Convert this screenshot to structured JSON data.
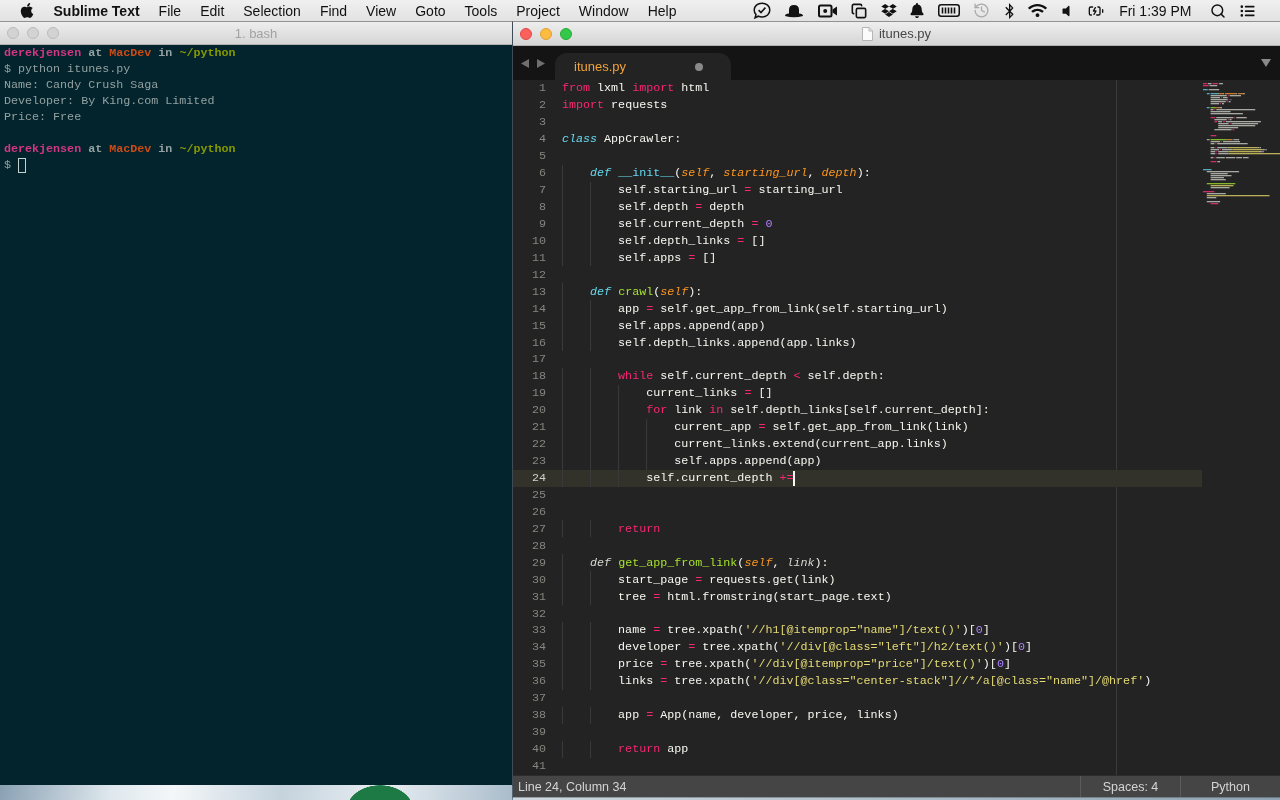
{
  "menu_bar": {
    "app_name": "Sublime Text",
    "menus": [
      "File",
      "Edit",
      "Selection",
      "Find",
      "View",
      "Goto",
      "Tools",
      "Project",
      "Window",
      "Help"
    ],
    "clock": "Fri 1:39 PM"
  },
  "terminal": {
    "title": "1. bash",
    "active": false,
    "lines": [
      {
        "kind": "prompt",
        "user": "derekjensen",
        "at": "at",
        "host": "MacDev",
        "in": "in",
        "path": "~/python"
      },
      {
        "kind": "command",
        "text": "$ python itunes.py"
      },
      {
        "kind": "output",
        "text": "Name: Candy Crush Saga"
      },
      {
        "kind": "output",
        "text": "Developer: By King.com Limited"
      },
      {
        "kind": "output",
        "text": "Price: Free"
      },
      {
        "kind": "blank"
      },
      {
        "kind": "prompt",
        "user": "derekjensen",
        "at": "at",
        "host": "MacDev",
        "in": "in",
        "path": "~/python"
      },
      {
        "kind": "input",
        "text": "$"
      }
    ]
  },
  "editor": {
    "title": "itunes.py",
    "active": true,
    "tabs": [
      {
        "label": "itunes.py",
        "selected": true,
        "modified": true
      }
    ],
    "lines": [
      {
        "number": "1",
        "current": false,
        "tokens": [
          {
            "kind": "keyword",
            "text": "from"
          },
          {
            "kind": "text",
            "text": " lxml "
          },
          {
            "kind": "keyword",
            "text": "import"
          },
          {
            "kind": "text",
            "text": " html"
          }
        ]
      },
      {
        "number": "2",
        "current": false,
        "tokens": [
          {
            "kind": "keyword",
            "text": "import"
          },
          {
            "kind": "text",
            "text": " requests"
          }
        ]
      },
      {
        "number": "3",
        "current": false
      },
      {
        "number": "4",
        "current": false,
        "tokens": [
          {
            "kind": "storage",
            "text": "class"
          },
          {
            "kind": "text",
            "text": " AppCrawler:"
          }
        ]
      },
      {
        "number": "5",
        "current": false
      },
      {
        "number": "6",
        "current": false,
        "tokens": [
          {
            "kind": "storage",
            "text": "    def "
          },
          {
            "kind": "support",
            "text": "__init__"
          },
          {
            "kind": "text",
            "text": "("
          },
          {
            "kind": "param",
            "text": "self"
          },
          {
            "kind": "text",
            "text": ", "
          },
          {
            "kind": "param",
            "text": "starting_url"
          },
          {
            "kind": "text",
            "text": ", "
          },
          {
            "kind": "param",
            "text": "depth"
          },
          {
            "kind": "text",
            "text": "):"
          }
        ]
      },
      {
        "number": "7",
        "current": false,
        "tokens": [
          {
            "kind": "text",
            "text": "        self.starting_url "
          },
          {
            "kind": "operator",
            "text": "="
          },
          {
            "kind": "text",
            "text": " starting_url"
          }
        ]
      },
      {
        "number": "8",
        "current": false,
        "tokens": [
          {
            "kind": "text",
            "text": "        self.depth "
          },
          {
            "kind": "operator",
            "text": "="
          },
          {
            "kind": "text",
            "text": " depth"
          }
        ]
      },
      {
        "number": "9",
        "current": false,
        "tokens": [
          {
            "kind": "text",
            "text": "        self.current_depth "
          },
          {
            "kind": "operator",
            "text": "= "
          },
          {
            "kind": "number",
            "text": "0"
          }
        ]
      },
      {
        "number": "10",
        "current": false,
        "tokens": [
          {
            "kind": "text",
            "text": "        self.depth_links "
          },
          {
            "kind": "operator",
            "text": "="
          },
          {
            "kind": "text",
            "text": " []"
          }
        ]
      },
      {
        "number": "11",
        "current": false,
        "tokens": [
          {
            "kind": "text",
            "text": "        self.apps "
          },
          {
            "kind": "operator",
            "text": "="
          },
          {
            "kind": "text",
            "text": " []"
          }
        ]
      },
      {
        "number": "12",
        "current": false
      },
      {
        "number": "13",
        "current": false,
        "tokens": [
          {
            "kind": "storage",
            "text": "    def "
          },
          {
            "kind": "function",
            "text": "crawl"
          },
          {
            "kind": "text",
            "text": "("
          },
          {
            "kind": "param",
            "text": "self"
          },
          {
            "kind": "text",
            "text": "):"
          }
        ]
      },
      {
        "number": "14",
        "current": false,
        "tokens": [
          {
            "kind": "text",
            "text": "        app "
          },
          {
            "kind": "operator",
            "text": "="
          },
          {
            "kind": "text",
            "text": " self.get_app_from_link(self.starting_url)"
          }
        ]
      },
      {
        "number": "15",
        "current": false,
        "tokens": [
          {
            "kind": "text",
            "text": "        self.apps.append(app)"
          }
        ]
      },
      {
        "number": "16",
        "current": false,
        "tokens": [
          {
            "kind": "text",
            "text": "        self.depth_links.append(app.links)"
          }
        ]
      },
      {
        "number": "17",
        "current": false
      },
      {
        "number": "18",
        "current": false,
        "tokens": [
          {
            "kind": "keyword",
            "text": "        while"
          },
          {
            "kind": "text",
            "text": " self.current_depth "
          },
          {
            "kind": "operator",
            "text": "<"
          },
          {
            "kind": "text",
            "text": " self.depth:"
          }
        ]
      },
      {
        "number": "19",
        "current": false,
        "tokens": [
          {
            "kind": "text",
            "text": "            current_links "
          },
          {
            "kind": "operator",
            "text": "="
          },
          {
            "kind": "text",
            "text": " []"
          }
        ]
      },
      {
        "number": "20",
        "current": false,
        "tokens": [
          {
            "kind": "keyword",
            "text": "            for"
          },
          {
            "kind": "text",
            "text": " link "
          },
          {
            "kind": "keyword",
            "text": "in"
          },
          {
            "kind": "text",
            "text": " self.depth_links[self.current_depth]:"
          }
        ]
      },
      {
        "number": "21",
        "current": false,
        "tokens": [
          {
            "kind": "text",
            "text": "                current_app "
          },
          {
            "kind": "operator",
            "text": "="
          },
          {
            "kind": "text",
            "text": " self.get_app_from_link(link)"
          }
        ]
      },
      {
        "number": "22",
        "current": false,
        "tokens": [
          {
            "kind": "text",
            "text": "                current_links.extend(current_app.links)"
          }
        ]
      },
      {
        "number": "23",
        "current": false,
        "tokens": [
          {
            "kind": "text",
            "text": "                self.apps.append(app)"
          }
        ]
      },
      {
        "number": "24",
        "current": true,
        "tokens": [
          {
            "kind": "text",
            "text": "            self.current_depth "
          },
          {
            "kind": "operator",
            "text": "+="
          }
        ]
      },
      {
        "number": "25",
        "current": false
      },
      {
        "number": "26",
        "current": false
      },
      {
        "number": "27",
        "current": false,
        "tokens": [
          {
            "kind": "keyword",
            "text": "        return"
          }
        ]
      },
      {
        "number": "28",
        "current": false
      },
      {
        "number": "29",
        "current": false,
        "tokens": [
          {
            "kind": "italic",
            "text": "    def "
          },
          {
            "kind": "function",
            "text": "get_app_from_link"
          },
          {
            "kind": "text",
            "text": "("
          },
          {
            "kind": "param",
            "text": "self"
          },
          {
            "kind": "text",
            "text": ", "
          },
          {
            "kind": "italic",
            "text": "link"
          },
          {
            "kind": "text",
            "text": "):"
          }
        ]
      },
      {
        "number": "30",
        "current": false,
        "tokens": [
          {
            "kind": "text",
            "text": "        start_page "
          },
          {
            "kind": "operator",
            "text": "="
          },
          {
            "kind": "text",
            "text": " requests.get(link)"
          }
        ]
      },
      {
        "number": "31",
        "current": false,
        "tokens": [
          {
            "kind": "text",
            "text": "        tree "
          },
          {
            "kind": "operator",
            "text": "="
          },
          {
            "kind": "text",
            "text": " html.fromstring(start_page.text)"
          }
        ]
      },
      {
        "number": "32",
        "current": false
      },
      {
        "number": "33",
        "current": false,
        "tokens": [
          {
            "kind": "text",
            "text": "        name "
          },
          {
            "kind": "operator",
            "text": "="
          },
          {
            "kind": "text",
            "text": " tree.xpath("
          },
          {
            "kind": "string",
            "text": "'//h1[@itemprop=\"name\"]/text()'"
          },
          {
            "kind": "text",
            "text": ")["
          },
          {
            "kind": "number",
            "text": "0"
          },
          {
            "kind": "text",
            "text": "]"
          }
        ]
      },
      {
        "number": "34",
        "current": false,
        "tokens": [
          {
            "kind": "text",
            "text": "        developer "
          },
          {
            "kind": "operator",
            "text": "="
          },
          {
            "kind": "text",
            "text": " tree.xpath("
          },
          {
            "kind": "string",
            "text": "'//div[@class=\"left\"]/h2/text()'"
          },
          {
            "kind": "text",
            "text": ")["
          },
          {
            "kind": "number",
            "text": "0"
          },
          {
            "kind": "text",
            "text": "]"
          }
        ]
      },
      {
        "number": "35",
        "current": false,
        "tokens": [
          {
            "kind": "text",
            "text": "        price "
          },
          {
            "kind": "operator",
            "text": "="
          },
          {
            "kind": "text",
            "text": " tree.xpath("
          },
          {
            "kind": "string",
            "text": "'//div[@itemprop=\"price\"]/text()'"
          },
          {
            "kind": "text",
            "text": ")["
          },
          {
            "kind": "number",
            "text": "0"
          },
          {
            "kind": "text",
            "text": "]"
          }
        ]
      },
      {
        "number": "36",
        "current": false,
        "tokens": [
          {
            "kind": "text",
            "text": "        links "
          },
          {
            "kind": "operator",
            "text": "="
          },
          {
            "kind": "text",
            "text": " tree.xpath("
          },
          {
            "kind": "string",
            "text": "'//div[@class=\"center-stack\"]//*/a[@class=\"name\"]/@href'"
          },
          {
            "kind": "text",
            "text": ")"
          }
        ]
      },
      {
        "number": "37",
        "current": false
      },
      {
        "number": "38",
        "current": false,
        "tokens": [
          {
            "kind": "text",
            "text": "        app "
          },
          {
            "kind": "operator",
            "text": "="
          },
          {
            "kind": "text",
            "text": " App(name, developer, price, links)"
          }
        ]
      },
      {
        "number": "39",
        "current": false
      },
      {
        "number": "40",
        "current": false,
        "tokens": [
          {
            "kind": "keyword",
            "text": "        return"
          },
          {
            "kind": "text",
            "text": " app"
          }
        ]
      },
      {
        "number": "41",
        "current": false
      }
    ],
    "status_bar": {
      "position": "Line 24, Column 34",
      "indentation": "Spaces: 4",
      "syntax": "Python"
    }
  }
}
